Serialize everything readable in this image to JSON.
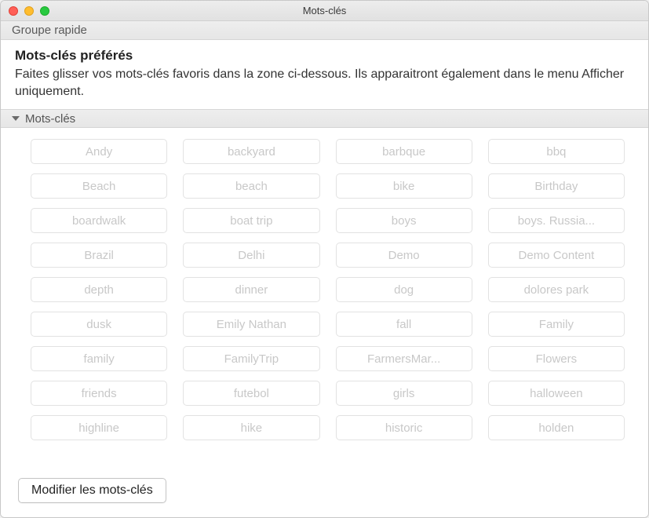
{
  "window": {
    "title": "Mots-clés"
  },
  "subheader": {
    "label": "Groupe rapide"
  },
  "preferred": {
    "title": "Mots-clés préférés",
    "description": "Faites glisser vos mots-clés favoris dans la zone ci-dessous. Ils apparaitront également dans le menu Afficher uniquement."
  },
  "section": {
    "label": "Mots-clés"
  },
  "keywords": [
    "Andy",
    "backyard",
    "barbque",
    "bbq",
    "Beach",
    "beach",
    "bike",
    "Birthday",
    "boardwalk",
    "boat trip",
    "boys",
    "boys. Russia...",
    "Brazil",
    "Delhi",
    "Demo",
    "Demo Content",
    "depth",
    "dinner",
    "dog",
    "dolores park",
    "dusk",
    "Emily Nathan",
    "fall",
    "Family",
    "family",
    "FamilyTrip",
    "FarmersMar...",
    "Flowers",
    "friends",
    "futebol",
    "girls",
    "halloween",
    "highline",
    "hike",
    "historic",
    "holden"
  ],
  "footer": {
    "edit_button": "Modifier les mots-clés"
  }
}
